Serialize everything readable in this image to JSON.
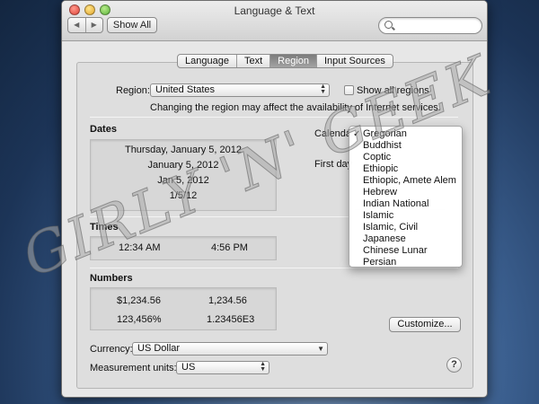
{
  "window": {
    "title": "Language & Text",
    "show_all": "Show All",
    "nav_back": "◀",
    "nav_forward": "▶"
  },
  "tabs": [
    "Language",
    "Text",
    "Region",
    "Input Sources"
  ],
  "selected_tab": "Region",
  "region": {
    "label": "Region:",
    "value": "United States",
    "show_all_regions": "Show all regions",
    "show_all_checked": false,
    "notice": "Changing the region may affect the availability of Internet services."
  },
  "dates": {
    "heading": "Dates",
    "samples": [
      "Thursday, January 5, 2012",
      "January 5, 2012",
      "Jan 5, 2012",
      "1/5/12"
    ],
    "calendar_label": "Calendar",
    "first_day_label": "First day"
  },
  "times": {
    "heading": "Times",
    "samples": [
      "12:34 AM",
      "4:56 PM"
    ]
  },
  "numbers": {
    "heading": "Numbers",
    "samples": [
      "$1,234.56",
      "1,234.56",
      "123,456%",
      "1.23456E3"
    ]
  },
  "customize_button": "Customize...",
  "currency": {
    "label": "Currency:",
    "value": "US Dollar"
  },
  "measurement": {
    "label": "Measurement units:",
    "value": "US"
  },
  "help": "?",
  "calendar_menu": {
    "selected": "Gregorian",
    "items": [
      "Gregorian",
      "Buddhist",
      "Coptic",
      "Ethiopic",
      "Ethiopic, Amete Alem",
      "Hebrew",
      "Indian National",
      "Islamic",
      "Islamic, Civil",
      "Japanese",
      "Chinese Lunar",
      "Persian"
    ]
  },
  "watermark": "GIRLY 'N' GEEK",
  "colors": {
    "selected_tab": "#8c8c8c",
    "window_bg": "#e7e7e7",
    "desktop": "#2a4a78"
  }
}
